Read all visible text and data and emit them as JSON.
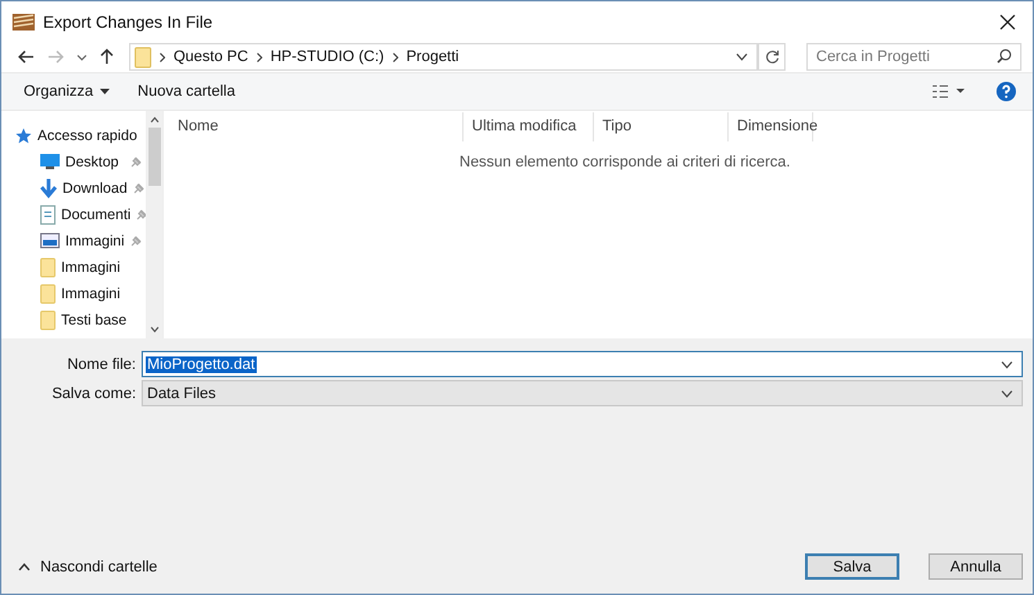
{
  "window": {
    "title": "Export Changes In File"
  },
  "breadcrumb": [
    "Questo PC",
    "HP-STUDIO (C:)",
    "Progetti"
  ],
  "search": {
    "placeholder": "Cerca in Progetti"
  },
  "toolbar": {
    "organize": "Organizza",
    "new_folder": "Nuova cartella"
  },
  "sidebar": {
    "items": [
      {
        "label": "Accesso rapido",
        "kind": "star",
        "pinned": false
      },
      {
        "label": "Desktop",
        "kind": "desktop",
        "pinned": true
      },
      {
        "label": "Download",
        "kind": "download",
        "pinned": true
      },
      {
        "label": "Documenti",
        "kind": "document",
        "pinned": true
      },
      {
        "label": "Immagini",
        "kind": "image",
        "pinned": true
      },
      {
        "label": "Immagini",
        "kind": "folder",
        "pinned": false
      },
      {
        "label": "Immagini",
        "kind": "folder",
        "pinned": false
      },
      {
        "label": "Testi base",
        "kind": "folder",
        "pinned": false
      }
    ]
  },
  "table": {
    "columns": [
      "Nome",
      "Ultima modifica",
      "Tipo",
      "Dimensione"
    ],
    "empty_message": "Nessun elemento corrisponde ai criteri di ricerca."
  },
  "form": {
    "file_name_label": "Nome file:",
    "file_name": "MioProgetto.dat",
    "save_as_label": "Salva come:",
    "save_as": "Data Files"
  },
  "footer": {
    "hide_folders": "Nascondi cartelle",
    "buttons": [
      "Salva",
      "Annulla"
    ]
  }
}
